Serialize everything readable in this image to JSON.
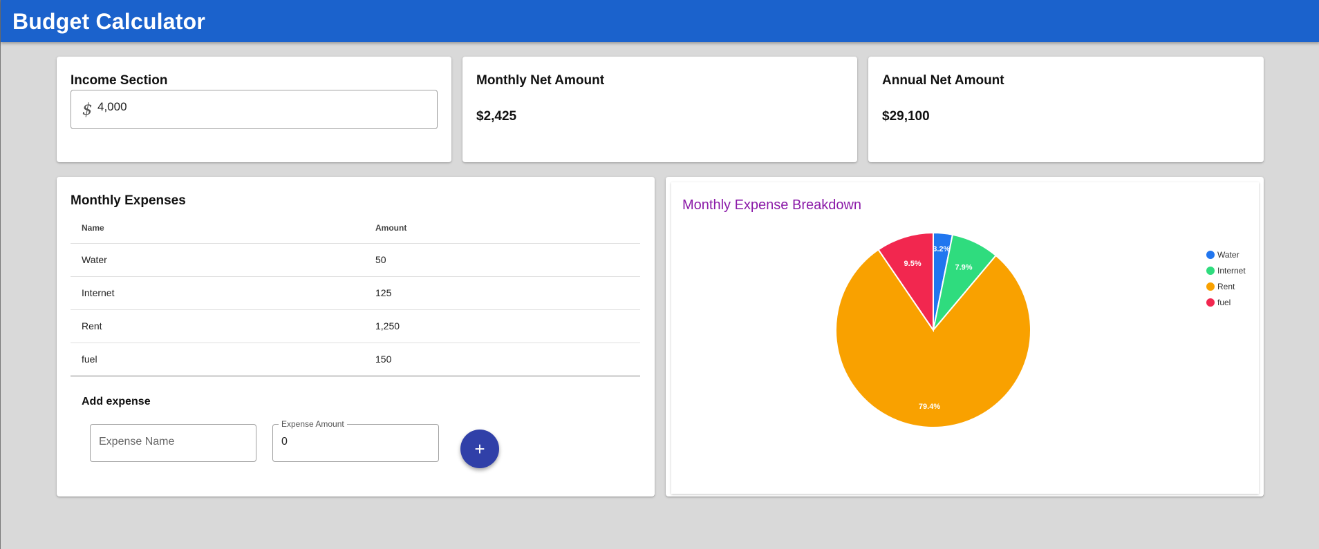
{
  "app": {
    "title": "Budget Calculator"
  },
  "income": {
    "title": "Income Section",
    "currency_symbol": "$",
    "value": "4,000"
  },
  "monthly_net": {
    "title": "Monthly Net Amount",
    "value": "$2,425"
  },
  "annual_net": {
    "title": "Annual Net Amount",
    "value": "$29,100"
  },
  "expenses": {
    "title": "Monthly Expenses",
    "columns": {
      "name": "Name",
      "amount": "Amount"
    },
    "rows": [
      {
        "name": "Water",
        "amount": "50"
      },
      {
        "name": "Internet",
        "amount": "125"
      },
      {
        "name": "Rent",
        "amount": "1,250"
      },
      {
        "name": "fuel",
        "amount": "150"
      }
    ],
    "add_title": "Add expense",
    "name_placeholder": "Expense Name",
    "amount_label": "Expense Amount",
    "amount_value": "0",
    "add_button_icon": "plus-icon",
    "add_button_glyph": "+"
  },
  "colors": {
    "appbar": "#1b62cc",
    "fab": "#3040a8",
    "chart_title": "#8b1aa8"
  },
  "chart_data": {
    "type": "pie",
    "title": "Monthly Expense Breakdown",
    "categories": [
      "Water",
      "Internet",
      "Rent",
      "fuel"
    ],
    "values": [
      50,
      125,
      1250,
      150
    ],
    "percent_labels": [
      "3.2%",
      "7.9%",
      "79.4%",
      "9.5%"
    ],
    "colors": [
      "#2176ef",
      "#2fdc7e",
      "#f9a100",
      "#f2274f"
    ],
    "legend": {
      "position": "right",
      "entries": [
        "Water",
        "Internet",
        "Rent",
        "fuel"
      ]
    }
  }
}
